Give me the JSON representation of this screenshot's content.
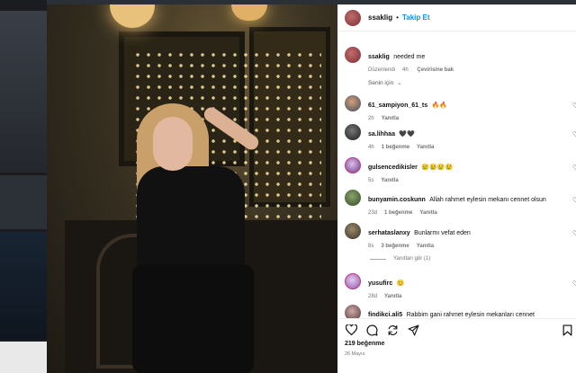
{
  "post": {
    "username": "ssaklig",
    "separator": "•",
    "follow_label": "Takip Et"
  },
  "caption": {
    "username": "ssaklig",
    "text": "needed me",
    "edited": "Düzenlendi",
    "age": "4h",
    "translate": "Çevirisine bak"
  },
  "for_you_label": "Senin için",
  "comments": [
    {
      "username": "61_sampiyon_61_ts",
      "text": "🔥🔥",
      "age": "2h",
      "likes": "",
      "reply": "Yanıtla"
    },
    {
      "username": "sa.lihhaa",
      "text": "🖤🖤",
      "age": "4h",
      "likes": "1 beğenme",
      "reply": "Yanıtla"
    },
    {
      "username": "gulsencedikisler",
      "text": "😢😢😢😢",
      "age": "5s",
      "likes": "",
      "reply": "Yanıtla"
    },
    {
      "username": "bunyamin.coskunn",
      "text": "Allah rahmet eylesin mekanı cennet olsun",
      "age": "23d",
      "likes": "1 beğenme",
      "reply": "Yanıtla"
    },
    {
      "username": "serhataslanxy",
      "text": "Bunlarmı vefat eden",
      "age": "8s",
      "likes": "3 beğenme",
      "reply": "Yanıtla"
    },
    {
      "username": "yusufirc",
      "text": "😊",
      "age": "28d",
      "likes": "",
      "reply": "Yanıtla"
    },
    {
      "username": "findikci.ali5",
      "text": "Rabbim gani rahmet eylesin mekanları cennet",
      "age": "",
      "likes": "",
      "reply": ""
    }
  ],
  "view_replies": "Yanıtları gör (1)",
  "likes_count": "219 beğenme",
  "post_date": "26 Mayıs",
  "icons": {
    "like": "heart-icon",
    "comment": "comment-icon",
    "share": "share-icon",
    "send": "send-icon",
    "save": "bookmark-icon"
  }
}
